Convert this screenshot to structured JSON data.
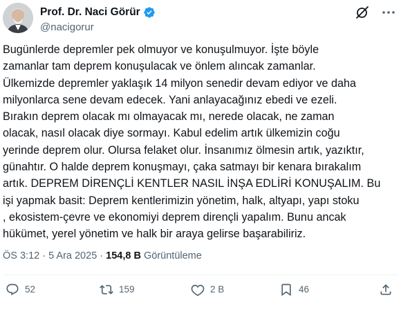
{
  "author": {
    "display_name": "Prof. Dr. Naci Görür",
    "handle": "@nacigorur",
    "verified": true,
    "avatar_icon": "profile-photo"
  },
  "header_icons": [
    "grok-icon",
    "more-icon"
  ],
  "text_lines": [
    "Bugünlerde depremler pek olmuyor ve konuşulmuyor. İşte böyle",
    "zamanlar tam deprem konuşulacak ve önlem alıncak zamanlar.",
    "Ülkemizde depremler yaklaşık 14 milyon senedir devam ediyor ve daha",
    "milyonlarca sene devam edecek. Yani anlayacağınız ebedi ve ezeli.",
    "Bırakın deprem olacak mı olmayacak mı, nerede olacak, ne zaman",
    "olacak, nasıl olacak diye sormayı. Kabul edelim artık ülkemizin coğu",
    "yerinde deprem olur. Olursa felaket olur. İnsanımız ölmesin artık, yazıktır,",
    "günahtır. O halde deprem konuşmayı, çaka satmayı bir kenara bırakalım",
    "artık. DEPREM DİRENÇLİ KENTLER NASIL İNŞA EDLİRİ KONUŞALIM. Bu",
    "işi yapmak basit: Deprem kentlerimizin yönetim, halk, altyapı, yapı stoku",
    ", ekosistem-çevre ve ekonomiyi deprem dirençli yapalım. Bunu ancak",
    "hükümet, yerel yönetim ve halk bir araya gelirse başarabiliriz."
  ],
  "meta": {
    "time": "ÖS 3:12",
    "separator": "·",
    "date": "5 Ara 2025",
    "views_count": "154,8 B",
    "views_label": "Görüntüleme"
  },
  "actions": {
    "replies": "52",
    "reposts": "159",
    "likes": "2 B",
    "bookmarks": "46"
  },
  "colors": {
    "text": "#0f1419",
    "secondary": "#536471",
    "verified": "#1d9bf0",
    "divider": "#eff3f4"
  }
}
